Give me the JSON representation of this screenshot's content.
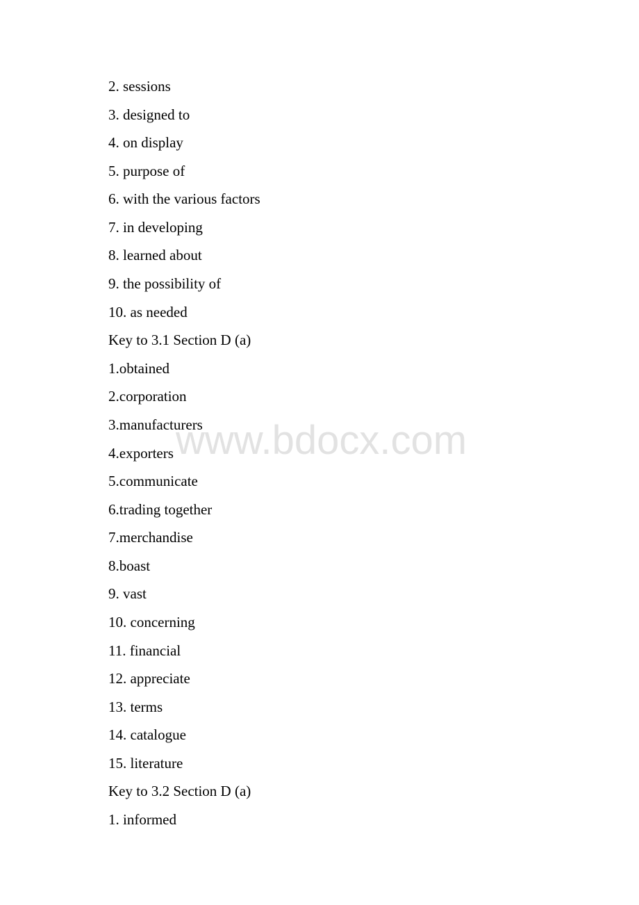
{
  "document": {
    "lines": [
      "2. sessions",
      "3. designed to",
      "4. on display",
      "5. purpose of",
      "6. with the various factors",
      "7. in developing",
      "8. learned about",
      "9. the possibility of",
      "10. as needed",
      "Key to 3.1 Section D (a)",
      "1.obtained",
      "2.corporation",
      "3.manufacturers",
      "4.exporters",
      "5.communicate",
      "6.trading together",
      "7.merchandise",
      "8.boast",
      "9. vast",
      "10. concerning",
      "11. financial",
      "12. appreciate",
      "13. terms",
      "14. catalogue",
      "15. literature",
      "Key to 3.2 Section D (a)",
      "1. informed"
    ]
  },
  "watermark": {
    "text": "www.bdocx.com",
    "color": "#e2e2e2"
  }
}
